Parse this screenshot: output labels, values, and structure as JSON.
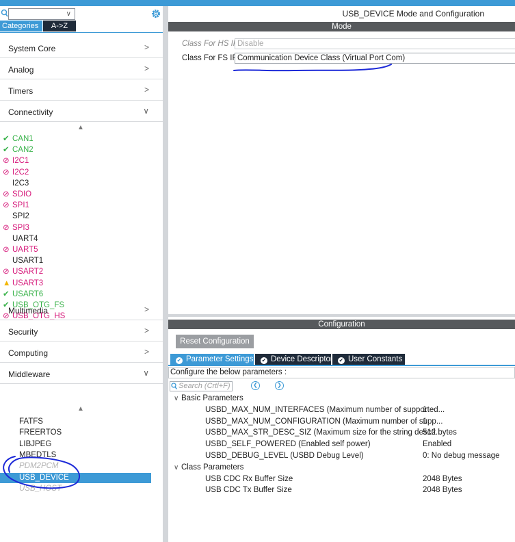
{
  "sidebar": {
    "search_value": "",
    "tabs": [
      "Categories",
      "A->Z"
    ],
    "categories": {
      "system_core": "System Core",
      "analog": "Analog",
      "timers": "Timers",
      "connectivity": "Connectivity",
      "multimedia": "Multimedia",
      "security": "Security",
      "computing": "Computing",
      "middleware": "Middleware"
    },
    "connectivity_items": [
      {
        "label": "CAN1",
        "status": "ok"
      },
      {
        "label": "CAN2",
        "status": "ok"
      },
      {
        "label": "I2C1",
        "status": "blocked"
      },
      {
        "label": "I2C2",
        "status": "blocked"
      },
      {
        "label": "I2C3",
        "status": "none"
      },
      {
        "label": "SDIO",
        "status": "blocked"
      },
      {
        "label": "SPI1",
        "status": "blocked"
      },
      {
        "label": "SPI2",
        "status": "none"
      },
      {
        "label": "SPI3",
        "status": "blocked"
      },
      {
        "label": "UART4",
        "status": "none"
      },
      {
        "label": "UART5",
        "status": "blocked"
      },
      {
        "label": "USART1",
        "status": "none"
      },
      {
        "label": "USART2",
        "status": "blocked"
      },
      {
        "label": "USART3",
        "status": "warning"
      },
      {
        "label": "USART6",
        "status": "ok"
      },
      {
        "label": "USB_OTG_FS",
        "status": "ok"
      },
      {
        "label": "USB_OTG_HS",
        "status": "blocked"
      }
    ],
    "middleware_items": [
      {
        "label": "FATFS",
        "state": "normal"
      },
      {
        "label": "FREERTOS",
        "state": "normal"
      },
      {
        "label": "LIBJPEG",
        "state": "normal"
      },
      {
        "label": "MBEDTLS",
        "state": "normal"
      },
      {
        "label": "PDM2PCM",
        "state": "disabled"
      },
      {
        "label": "USB_DEVICE",
        "state": "selected"
      },
      {
        "label": "USB_HOST",
        "state": "disabled"
      }
    ]
  },
  "mode": {
    "window_title": "USB_DEVICE Mode and Configuration",
    "section_title": "Mode",
    "hs_label": "Class For HS IP",
    "hs_value": "Disable",
    "fs_label": "Class For FS IP",
    "fs_value": "Communication Device Class (Virtual Port Com)"
  },
  "configuration": {
    "section_title": "Configuration",
    "reset_label": "Reset Configuration",
    "tabs": [
      "Parameter Settings",
      "Device Descriptor",
      "User Constants"
    ],
    "note": "Configure the below parameters :",
    "search_placeholder": "Search (Crtl+F)",
    "groups": [
      {
        "title": "Basic Parameters",
        "params": [
          {
            "name": "USBD_MAX_NUM_INTERFACES (Maximum number of supported...",
            "value": "1"
          },
          {
            "name": "USBD_MAX_NUM_CONFIGURATION (Maximum number of supp...",
            "value": "1"
          },
          {
            "name": "USBD_MAX_STR_DESC_SIZ (Maximum size for the string descri...",
            "value": "512 bytes"
          },
          {
            "name": "USBD_SELF_POWERED (Enabled self power)",
            "value": "Enabled"
          },
          {
            "name": "USBD_DEBUG_LEVEL (USBD Debug Level)",
            "value": "0: No debug message"
          }
        ]
      },
      {
        "title": "Class Parameters",
        "params": [
          {
            "name": "USB CDC Rx Buffer Size",
            "value": "2048 Bytes"
          },
          {
            "name": "USB CDC Tx Buffer Size",
            "value": "2048 Bytes"
          }
        ]
      }
    ]
  },
  "colors": {
    "accent": "#3d9ad6",
    "dark_tab": "#1f2b3a",
    "ok": "#38b249",
    "blocked": "#d6187a",
    "warning": "#f2b600",
    "annotation_pen": "#1d2ad8"
  }
}
